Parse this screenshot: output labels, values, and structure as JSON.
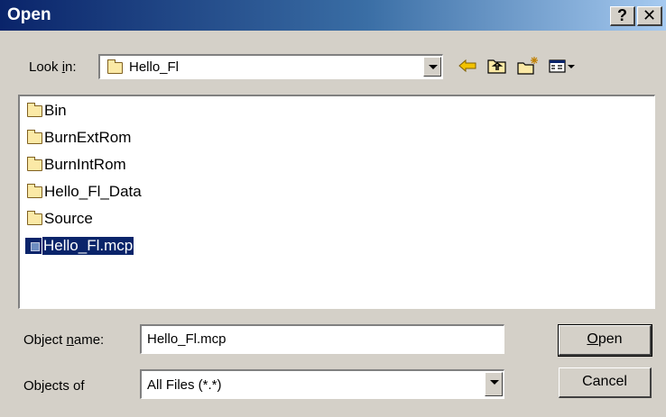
{
  "window": {
    "title": "Open",
    "help_label": "?",
    "close_label": "✕"
  },
  "look_in": {
    "label_prefix": "Look ",
    "label_mnemonic": "i",
    "label_suffix": "n:",
    "value": "Hello_Fl",
    "icon": "folder-icon"
  },
  "toolbar": {
    "back_icon": "back-arrow-icon",
    "up_icon": "up-folder-icon",
    "new_folder_icon": "new-folder-icon",
    "view_icon": "view-menu-icon"
  },
  "files": [
    {
      "name": "Bin",
      "type": "folder"
    },
    {
      "name": "BurnExtRom",
      "type": "folder"
    },
    {
      "name": "BurnIntRom",
      "type": "folder"
    },
    {
      "name": "Hello_Fl_Data",
      "type": "folder"
    },
    {
      "name": "Source",
      "type": "folder"
    },
    {
      "name": "Hello_Fl.mcp",
      "type": "file",
      "selected": true
    }
  ],
  "object_name": {
    "label_prefix": "Object ",
    "label_mnemonic": "n",
    "label_suffix": "ame:",
    "value": "Hello_Fl.mcp"
  },
  "objects_of": {
    "label": "Objects of",
    "value": "All Files (*.*)"
  },
  "buttons": {
    "open_mnemonic": "O",
    "open_rest": "pen",
    "cancel": "Cancel"
  }
}
